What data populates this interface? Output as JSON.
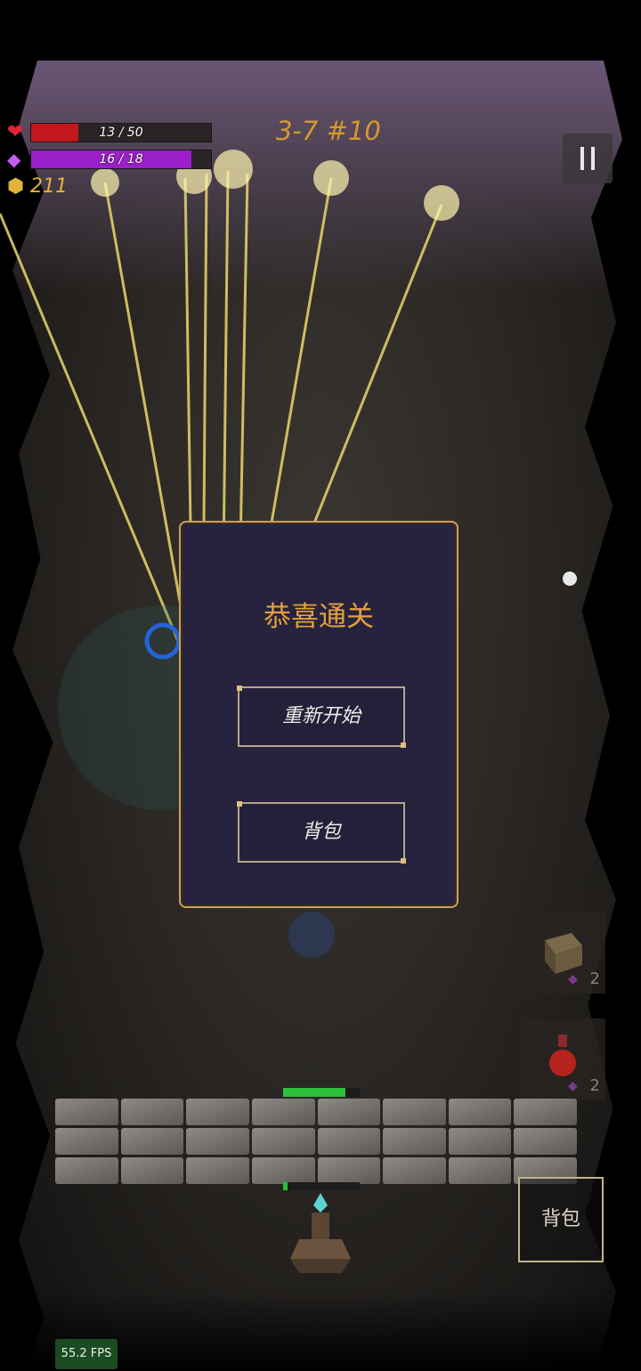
{
  "hud": {
    "health": {
      "icon": "heart-icon",
      "text": "13 / 50",
      "current": 13,
      "max": 50,
      "color": "#c4171d"
    },
    "mana": {
      "icon": "gem-icon",
      "text": "16 / 18",
      "current": 16,
      "max": 18,
      "color": "#9b1fc8"
    },
    "gold": {
      "icon": "coin-icon",
      "value": "211"
    },
    "level": "3-7 #10"
  },
  "dialog": {
    "title": "恭喜通关",
    "restart_label": "重新开始",
    "backpack_label": "背包"
  },
  "slots": [
    {
      "icon": "rune-cube-icon",
      "count": "2"
    },
    {
      "icon": "red-potion-icon",
      "count": "2"
    }
  ],
  "bag_button_label": "背包",
  "fps": "55.2 FPS",
  "colors": {
    "accent_gold": "#e4a13c",
    "dialog_bg": "#27233e",
    "beam": "#e8d76a"
  }
}
